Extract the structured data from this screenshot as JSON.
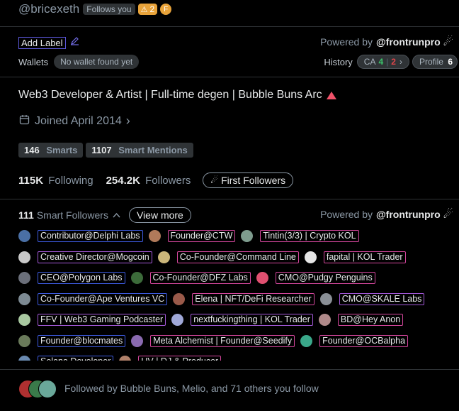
{
  "profile": {
    "handle": "@bricexeth",
    "follows_you": "Follows you",
    "badge_count": "2",
    "badge_f": "F"
  },
  "labels": {
    "add_label": "Add Label",
    "wallets_label": "Wallets",
    "no_wallet": "No wallet found yet",
    "powered_by": "Powered by",
    "brand": "@frontrunpro",
    "history": "History",
    "ca_label": "CA",
    "ca_green": "4",
    "ca_red": "2",
    "profile_label": "Profile",
    "profile_count": "6"
  },
  "bio": {
    "text": "Web3 Developer & Artist | Full-time degen | Bubble Buns Arc",
    "joined": "Joined April 2014"
  },
  "stats": {
    "smarts_count": "146",
    "smarts_label": "Smarts",
    "mentions_count": "1107",
    "mentions_label": "Smart Mentions",
    "following_count": "115K",
    "following_label": "Following",
    "followers_count": "254.2K",
    "followers_label": "Followers",
    "first_followers": "First Followers"
  },
  "smart_followers": {
    "count": "111",
    "label": "Smart Followers",
    "view_more": "View more",
    "powered_by": "Powered by",
    "brand": "@frontrunpro",
    "rows": [
      [
        {
          "label": "Contributor@Delphi Labs",
          "color": "blue",
          "avatar": "#4a6fa5"
        },
        {
          "label": "Founder@CTW",
          "color": "pink",
          "avatar": "#b07a5a"
        },
        {
          "label": "Tintin(3/3) | Crypto KOL",
          "color": "pink",
          "avatar": "#7e9c8e"
        }
      ],
      [
        {
          "label": "Creative Director@Mogcoin",
          "color": "purple",
          "avatar": "#c9c9c9"
        },
        {
          "label": "Co-Founder@Command Line",
          "color": "pink",
          "avatar": "#cbb67a"
        },
        {
          "label": "fapital | KOL Trader",
          "color": "pink",
          "avatar": "#e6e6e6"
        }
      ],
      [
        {
          "label": "CEO@Polygon Labs",
          "color": "blue",
          "avatar": "#6b6f7a"
        },
        {
          "label": "Co-Founder@DFZ Labs",
          "color": "pink",
          "avatar": "#3c6b3a"
        },
        {
          "label": "CMO@Pudgy Penguins",
          "color": "pink",
          "avatar": "#e05070"
        }
      ],
      [
        {
          "label": "Co-Founder@Ape Ventures VC",
          "color": "blue",
          "avatar": "#7d8a93"
        },
        {
          "label": "Elena | NFT/DeFi Researcher",
          "color": "pink",
          "avatar": "#9a5a4a"
        },
        {
          "label": "CMO@SKALE Labs",
          "color": "purple",
          "avatar": "#8a8f96"
        }
      ],
      [
        {
          "label": "FFV | Web3 Gaming Podcaster",
          "color": "purple",
          "avatar": "#a8c8a0"
        },
        {
          "label": "nextfuckingthing | KOL Trader",
          "color": "purple",
          "avatar": "#a0a8d8"
        },
        {
          "label": "BD@Hey Anon",
          "color": "pink",
          "avatar": "#b08a8a"
        }
      ],
      [
        {
          "label": "Founder@blocmates",
          "color": "blue",
          "avatar": "#6a7a5a"
        },
        {
          "label": "Meta Alchemist | Founder@Seedify",
          "color": "pink",
          "avatar": "#8a6ab0"
        },
        {
          "label": "Founder@OCBalpha",
          "color": "pink",
          "avatar": "#3aa88a"
        }
      ],
      [
        {
          "label": "Solana Developer",
          "color": "blue",
          "avatar": "#6a8ab0"
        },
        {
          "label": "UV | DJ & Producer",
          "color": "pink",
          "avatar": "#b0806a"
        }
      ]
    ]
  },
  "followed_by": {
    "text": "Followed by Bubble Buns, Melio, and 71 others you follow"
  }
}
